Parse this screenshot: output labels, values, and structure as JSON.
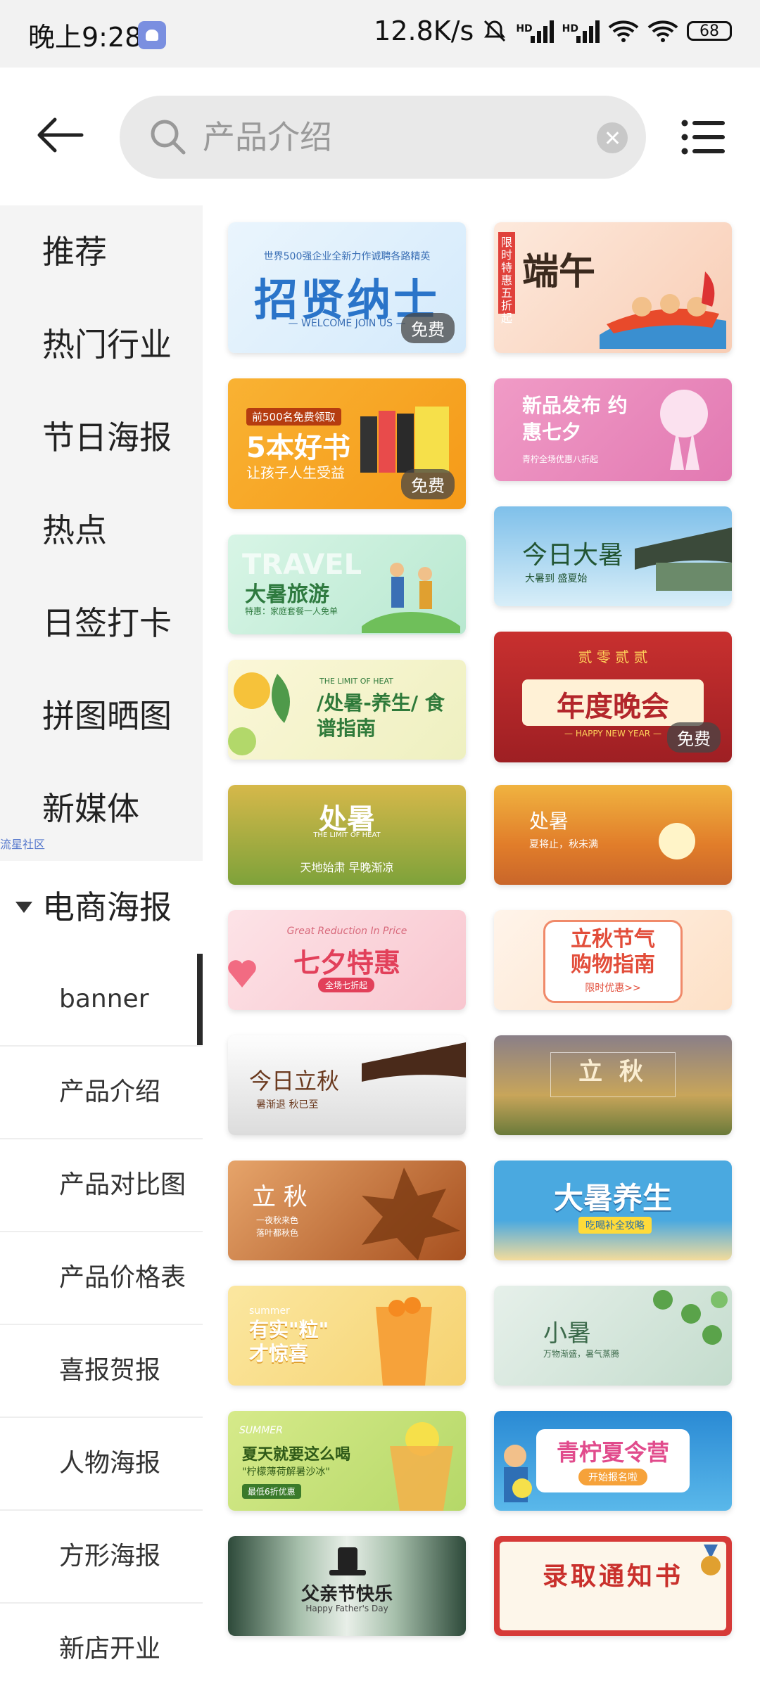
{
  "status_bar": {
    "time": "晚上9:28",
    "speed": "12.8K/s",
    "hd_label": "HD",
    "battery": "68"
  },
  "search": {
    "placeholder": "产品介绍"
  },
  "sidebar": {
    "categories": [
      "推荐",
      "热门行业",
      "节日海报",
      "热点",
      "日签打卡",
      "拼图晒图",
      "新媒体"
    ],
    "floating_tag": "流星社区",
    "expanded": "电商海报",
    "subcategories": [
      "banner",
      "产品介绍",
      "产品对比图",
      "产品价格表",
      "喜报贺报",
      "人物海报",
      "方形海报",
      "新店开业"
    ],
    "active_sub": "banner"
  },
  "templates": [
    {
      "title": "招贤纳士",
      "top": "世界500强企业全新力作诚聘各路精英",
      "subtitle": "— WELCOME JOIN US —",
      "badge": "免费",
      "bg": "#e3f1fb",
      "color": "#2a74c9"
    },
    {
      "title": "端午",
      "top": "限时特惠五折起",
      "subtitle": "",
      "badge": "",
      "bg": "#fbe0d2",
      "color": "#3b2a1e"
    },
    {
      "title": "5本好书",
      "top": "前500名免费领取",
      "subtitle": "让孩子人生受益",
      "badge": "免费",
      "bg": "#f7a823",
      "color": "#ffffff"
    },
    {
      "title": "新品发布 约惠七夕",
      "top": "",
      "subtitle": "青柠全场优惠八折起",
      "badge": "",
      "bg": "#ea8ec0",
      "color": "#ffffff"
    },
    {
      "title": "大暑旅游",
      "top": "TRAVEL",
      "subtitle": "特惠：家庭套餐一人免单",
      "badge": "",
      "bg": "#c9efdc",
      "color": "#2e7a3f"
    },
    {
      "title": "今日大暑",
      "top": "",
      "subtitle": "大暑到 盛夏始",
      "badge": "",
      "bg": "#8fc8e8",
      "color": "#225533"
    },
    {
      "title": "/处暑-养生/ 食谱指南",
      "top": "THE LIMIT OF HEAT",
      "subtitle": "",
      "badge": "",
      "bg": "#f3efc9",
      "color": "#2f7a3a"
    },
    {
      "title": "年度晚会",
      "top": "贰 零 贰 贰",
      "subtitle": "— HAPPY NEW YEAR —",
      "badge": "免费",
      "bg": "#b3262b",
      "color": "#b3262b"
    },
    {
      "title": "处暑",
      "top": "THE LIMIT OF HEAT",
      "subtitle": "天地始肃 早晚渐凉",
      "badge": "",
      "bg": "#a5b84a",
      "color": "#ffffff"
    },
    {
      "title": "处暑",
      "top": "",
      "subtitle": "夏将止，秋未满",
      "badge": "",
      "bg": "#e9a53a",
      "color": "#ffffff"
    },
    {
      "title": "七夕特惠",
      "top": "Great Reduction In Price",
      "subtitle": "全场七折起",
      "badge": "",
      "bg": "#fbd3dc",
      "color": "#e2405a"
    },
    {
      "title": "立秋节气 购物指南",
      "top": "",
      "subtitle": "限时优惠>>",
      "badge": "",
      "bg": "#fde7d6",
      "color": "#e24d3a"
    },
    {
      "title": "今日立秋",
      "top": "",
      "subtitle": "暑渐退 秋已至",
      "badge": "",
      "bg": "#f1f1f1",
      "color": "#6b3a1f"
    },
    {
      "title": "立 秋",
      "top": "",
      "subtitle": "",
      "badge": "",
      "bg": "#8f7a55",
      "color": "#fbeed2"
    },
    {
      "title": "立 秋",
      "top": "",
      "subtitle": "一夜秋来色 落叶都秋色",
      "badge": "",
      "bg": "#b4672e",
      "color": "#ffffff"
    },
    {
      "title": "大暑养生",
      "top": "",
      "subtitle": "吃喝补全攻略",
      "badge": "",
      "bg": "#5ab0e2",
      "color": "#ffffff"
    },
    {
      "title": "有实\"粒\" 才惊喜",
      "top": "summer",
      "subtitle": "",
      "badge": "",
      "bg": "#f8dc86",
      "color": "#ffffff"
    },
    {
      "title": "小暑",
      "top": "",
      "subtitle": "万物渐盛，暑气蒸腾",
      "badge": "",
      "bg": "#d5e6dc",
      "color": "#3d6b4c"
    },
    {
      "title": "夏天就要这么喝",
      "top": "SUMMER",
      "subtitle": "\"柠檬薄荷解暑沙冰\"",
      "badge": "最低6折优惠",
      "bg": "#c8e07a",
      "color": "#2f5a18"
    },
    {
      "title": "青柠夏令营",
      "top": "",
      "subtitle": "开始报名啦",
      "badge": "",
      "bg": "#2e8fd6",
      "color": "#e14b8c"
    },
    {
      "title": "父亲节快乐",
      "top": "",
      "subtitle": "Happy Father's Day",
      "badge": "",
      "bg": "#3c5a45",
      "color": "#222222"
    },
    {
      "title": "录取通知书",
      "top": "",
      "subtitle": "",
      "badge": "",
      "bg": "#d63a38",
      "color": "#c9302c"
    }
  ]
}
